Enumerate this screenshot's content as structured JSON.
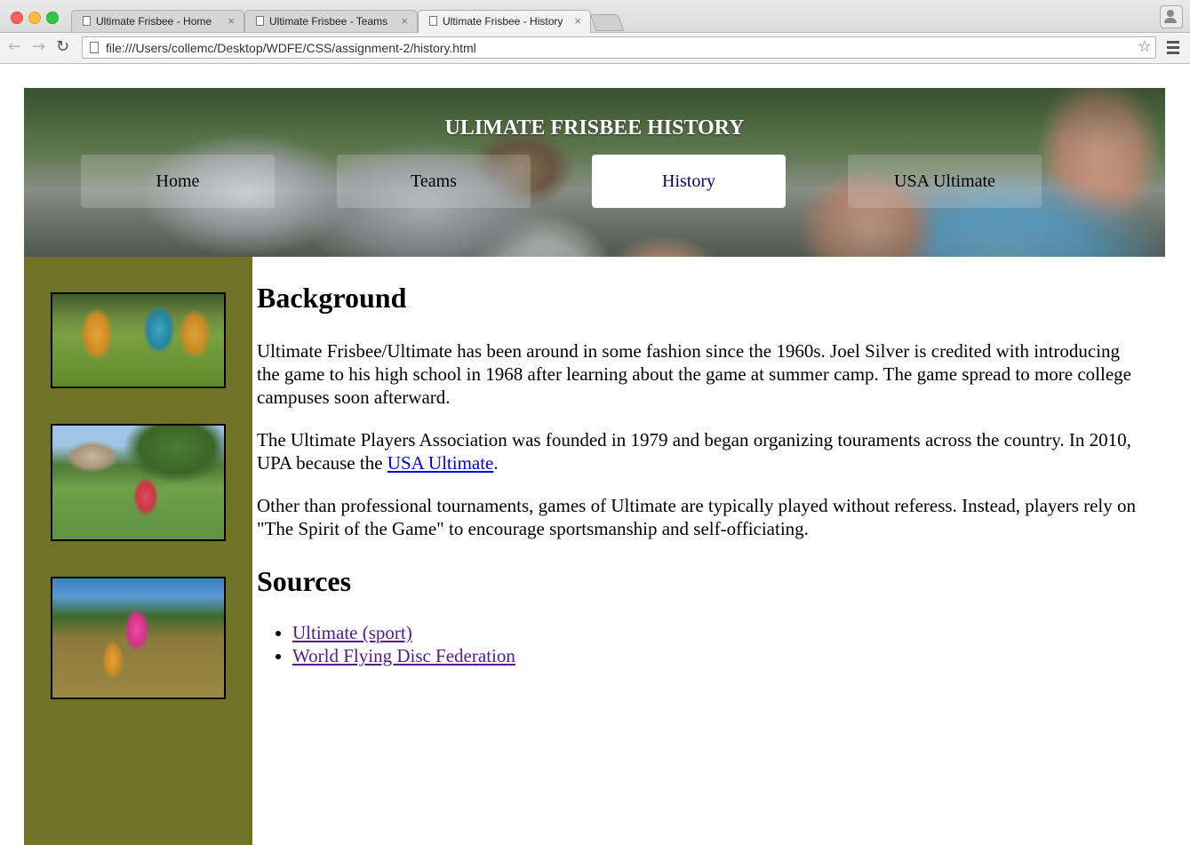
{
  "browser": {
    "tabs": [
      {
        "label": "Ultimate Frisbee - Home",
        "active": false
      },
      {
        "label": "Ultimate Frisbee - Teams",
        "active": false
      },
      {
        "label": "Ultimate Frisbee - History",
        "active": true
      }
    ],
    "tab_close_glyph": "×",
    "url": "file:///Users/collemc/Desktop/WDFE/CSS/assignment-2/history.html",
    "icons": {
      "back": "arrow-back-icon",
      "forward": "arrow-forward-icon",
      "reload": "reload-icon",
      "bookmark": "star-icon",
      "menu": "hamburger-menu-icon",
      "profile": "profile-icon"
    },
    "glyphs": {
      "back": "←",
      "forward": "→",
      "reload": "↻",
      "star": "☆"
    }
  },
  "header": {
    "title": "ULIMATE FRISBEE HISTORY",
    "nav": [
      {
        "label": "Home",
        "current": false
      },
      {
        "label": "Teams",
        "current": false
      },
      {
        "label": "History",
        "current": true
      },
      {
        "label": "USA Ultimate",
        "current": false
      }
    ]
  },
  "sidebar": {
    "images": [
      "frisbee-game-photo",
      "frisbee-field-photo",
      "frisbee-catch-photo"
    ],
    "background_color": "#707326"
  },
  "main": {
    "background_heading": "Background",
    "paragraphs": {
      "p1": "Ultimate Frisbee/Ultimate has been around in some fashion since the 1960s. Joel Silver is credited with introducing the game to his high school in 1968 after learning about the game at summer camp. The game spread to more college campuses soon afterward.",
      "p2_before_link": "The Ultimate Players Association was founded in 1979 and began organizing touraments across the country. In 2010, UPA because the ",
      "p2_link": "USA Ultimate",
      "p2_after_link": ".",
      "p3": "Other than professional tournaments, games of Ultimate are typically played without referess. Instead, players rely on \"The Spirit of the Game\" to encourage sportsmanship and self-officiating."
    },
    "sources_heading": "Sources",
    "sources": [
      "Ultimate (sport)",
      "World Flying Disc Federation"
    ]
  },
  "colors": {
    "link": "#0000ee",
    "visited_link": "#551a8b",
    "active_nav_text": "#000066"
  }
}
